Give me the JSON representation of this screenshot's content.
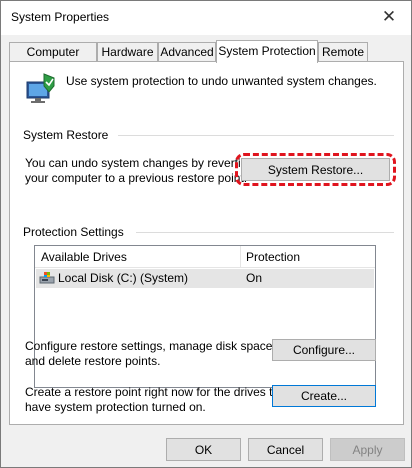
{
  "window": {
    "title": "System Properties",
    "close_glyph": "✕"
  },
  "tabs": [
    {
      "label": "Computer Name",
      "active": false
    },
    {
      "label": "Hardware",
      "active": false
    },
    {
      "label": "Advanced",
      "active": false
    },
    {
      "label": "System Protection",
      "active": true
    },
    {
      "label": "Remote",
      "active": false
    }
  ],
  "intro": {
    "icon": "system-protection-icon",
    "text": "Use system protection to undo unwanted system changes."
  },
  "system_restore": {
    "heading": "System Restore",
    "description_line1": "You can undo system changes by reverting",
    "description_line2": "your computer to a previous restore point.",
    "button_label": "System Restore..."
  },
  "protection_settings": {
    "heading": "Protection Settings",
    "columns": [
      "Available Drives",
      "Protection"
    ],
    "rows": [
      {
        "drive": "Local Disk (C:) (System)",
        "protection": "On",
        "icon": "drive-icon"
      }
    ]
  },
  "configure": {
    "line1": "Configure restore settings, manage disk space,",
    "line2": "and delete restore points.",
    "button_label": "Configure..."
  },
  "create": {
    "line1": "Create a restore point right now for the drives that",
    "line2": "have system protection turned on.",
    "button_label": "Create..."
  },
  "footer": {
    "ok": "OK",
    "cancel": "Cancel",
    "apply": "Apply"
  },
  "colors": {
    "highlight": "#e0141e",
    "focus_border": "#0078d7"
  }
}
